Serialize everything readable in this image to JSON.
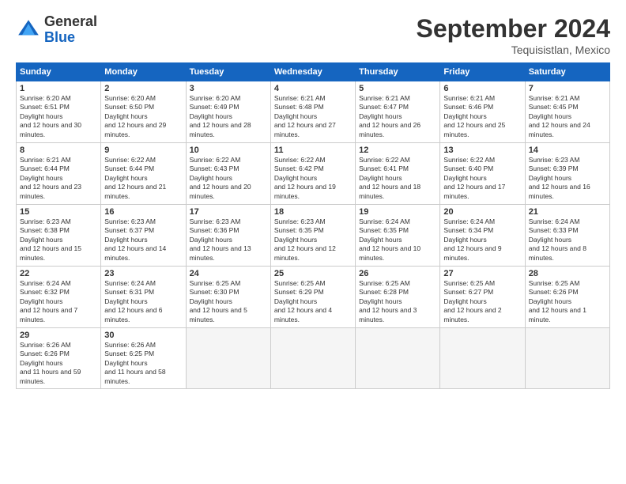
{
  "header": {
    "logo": {
      "general": "General",
      "blue": "Blue"
    },
    "title": "September 2024",
    "subtitle": "Tequisistlan, Mexico"
  },
  "calendar": {
    "days_of_week": [
      "Sunday",
      "Monday",
      "Tuesday",
      "Wednesday",
      "Thursday",
      "Friday",
      "Saturday"
    ],
    "weeks": [
      [
        {
          "day": 1,
          "sunrise": "6:20 AM",
          "sunset": "6:51 PM",
          "daylight": "12 hours and 30 minutes."
        },
        {
          "day": 2,
          "sunrise": "6:20 AM",
          "sunset": "6:50 PM",
          "daylight": "12 hours and 29 minutes."
        },
        {
          "day": 3,
          "sunrise": "6:20 AM",
          "sunset": "6:49 PM",
          "daylight": "12 hours and 28 minutes."
        },
        {
          "day": 4,
          "sunrise": "6:21 AM",
          "sunset": "6:48 PM",
          "daylight": "12 hours and 27 minutes."
        },
        {
          "day": 5,
          "sunrise": "6:21 AM",
          "sunset": "6:47 PM",
          "daylight": "12 hours and 26 minutes."
        },
        {
          "day": 6,
          "sunrise": "6:21 AM",
          "sunset": "6:46 PM",
          "daylight": "12 hours and 25 minutes."
        },
        {
          "day": 7,
          "sunrise": "6:21 AM",
          "sunset": "6:45 PM",
          "daylight": "12 hours and 24 minutes."
        }
      ],
      [
        {
          "day": 8,
          "sunrise": "6:21 AM",
          "sunset": "6:44 PM",
          "daylight": "12 hours and 23 minutes."
        },
        {
          "day": 9,
          "sunrise": "6:22 AM",
          "sunset": "6:44 PM",
          "daylight": "12 hours and 21 minutes."
        },
        {
          "day": 10,
          "sunrise": "6:22 AM",
          "sunset": "6:43 PM",
          "daylight": "12 hours and 20 minutes."
        },
        {
          "day": 11,
          "sunrise": "6:22 AM",
          "sunset": "6:42 PM",
          "daylight": "12 hours and 19 minutes."
        },
        {
          "day": 12,
          "sunrise": "6:22 AM",
          "sunset": "6:41 PM",
          "daylight": "12 hours and 18 minutes."
        },
        {
          "day": 13,
          "sunrise": "6:22 AM",
          "sunset": "6:40 PM",
          "daylight": "12 hours and 17 minutes."
        },
        {
          "day": 14,
          "sunrise": "6:23 AM",
          "sunset": "6:39 PM",
          "daylight": "12 hours and 16 minutes."
        }
      ],
      [
        {
          "day": 15,
          "sunrise": "6:23 AM",
          "sunset": "6:38 PM",
          "daylight": "12 hours and 15 minutes."
        },
        {
          "day": 16,
          "sunrise": "6:23 AM",
          "sunset": "6:37 PM",
          "daylight": "12 hours and 14 minutes."
        },
        {
          "day": 17,
          "sunrise": "6:23 AM",
          "sunset": "6:36 PM",
          "daylight": "12 hours and 13 minutes."
        },
        {
          "day": 18,
          "sunrise": "6:23 AM",
          "sunset": "6:35 PM",
          "daylight": "12 hours and 12 minutes."
        },
        {
          "day": 19,
          "sunrise": "6:24 AM",
          "sunset": "6:35 PM",
          "daylight": "12 hours and 10 minutes."
        },
        {
          "day": 20,
          "sunrise": "6:24 AM",
          "sunset": "6:34 PM",
          "daylight": "12 hours and 9 minutes."
        },
        {
          "day": 21,
          "sunrise": "6:24 AM",
          "sunset": "6:33 PM",
          "daylight": "12 hours and 8 minutes."
        }
      ],
      [
        {
          "day": 22,
          "sunrise": "6:24 AM",
          "sunset": "6:32 PM",
          "daylight": "12 hours and 7 minutes."
        },
        {
          "day": 23,
          "sunrise": "6:24 AM",
          "sunset": "6:31 PM",
          "daylight": "12 hours and 6 minutes."
        },
        {
          "day": 24,
          "sunrise": "6:25 AM",
          "sunset": "6:30 PM",
          "daylight": "12 hours and 5 minutes."
        },
        {
          "day": 25,
          "sunrise": "6:25 AM",
          "sunset": "6:29 PM",
          "daylight": "12 hours and 4 minutes."
        },
        {
          "day": 26,
          "sunrise": "6:25 AM",
          "sunset": "6:28 PM",
          "daylight": "12 hours and 3 minutes."
        },
        {
          "day": 27,
          "sunrise": "6:25 AM",
          "sunset": "6:27 PM",
          "daylight": "12 hours and 2 minutes."
        },
        {
          "day": 28,
          "sunrise": "6:25 AM",
          "sunset": "6:26 PM",
          "daylight": "12 hours and 1 minute."
        }
      ],
      [
        {
          "day": 29,
          "sunrise": "6:26 AM",
          "sunset": "6:26 PM",
          "daylight": "11 hours and 59 minutes."
        },
        {
          "day": 30,
          "sunrise": "6:26 AM",
          "sunset": "6:25 PM",
          "daylight": "11 hours and 58 minutes."
        },
        null,
        null,
        null,
        null,
        null
      ]
    ]
  }
}
